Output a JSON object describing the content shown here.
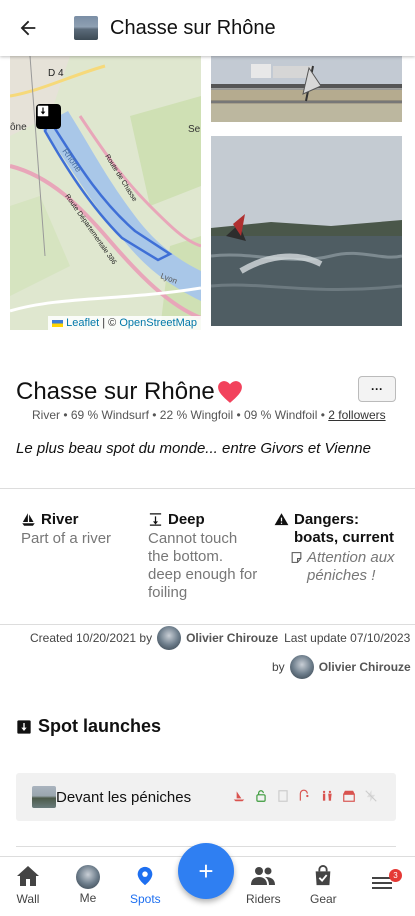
{
  "header": {
    "title": "Chasse sur Rhône"
  },
  "map": {
    "road_label": "D 4",
    "river_label": "Rhône",
    "road1": "Route de Chasse",
    "road2": "Route Départementale 386",
    "town_left": "ône",
    "town_right": "Se",
    "lyon_label": "Lyon",
    "attribution_leaflet": "Leaflet",
    "attribution_sep": "| ©",
    "attribution_osm": "OpenStreetMap"
  },
  "spot": {
    "name": "Chasse sur Rhône",
    "more_label": "···",
    "stats": "River • 69 % Windsurf • 22 % Wingfoil • 09 % Windfoil •",
    "followers": "2 followers",
    "tagline": "Le plus beau spot du monde... entre Givors et Vienne"
  },
  "attributes": [
    {
      "title": "River",
      "desc": "Part of a river",
      "icon": "sailboat-icon"
    },
    {
      "title": "Deep",
      "desc": "Cannot touch the bottom. deep enough for foiling",
      "icon": "depth-icon"
    },
    {
      "title": "Dangers: boats, current",
      "desc": "Attention aux péniches !",
      "icon": "warning-icon"
    }
  ],
  "meta": {
    "created": "Created 10/20/2021 by",
    "author": "Olivier Chirouze",
    "updated": "Last update 07/10/2023",
    "by": "by",
    "updater": "Olivier Chirouze"
  },
  "launches": {
    "title": "Spot launches",
    "items": [
      {
        "name": "Devant les péniches"
      }
    ]
  },
  "nav": {
    "items": [
      {
        "label": "Wall",
        "icon": "home-icon"
      },
      {
        "label": "Me",
        "icon": "avatar-icon"
      },
      {
        "label": "Spots",
        "icon": "location-pin-icon"
      },
      {
        "label": "Riders",
        "icon": "people-icon"
      },
      {
        "label": "Gear",
        "icon": "bag-icon"
      },
      {
        "label": "",
        "icon": "menu-icon"
      }
    ],
    "fab": "+",
    "badge": "3"
  },
  "colors": {
    "accent": "#1e6ff0",
    "fab": "#2f7ff2",
    "heart": "#f2425c",
    "danger_icons": "#d9534f",
    "green_icon": "#3a9a3a"
  }
}
